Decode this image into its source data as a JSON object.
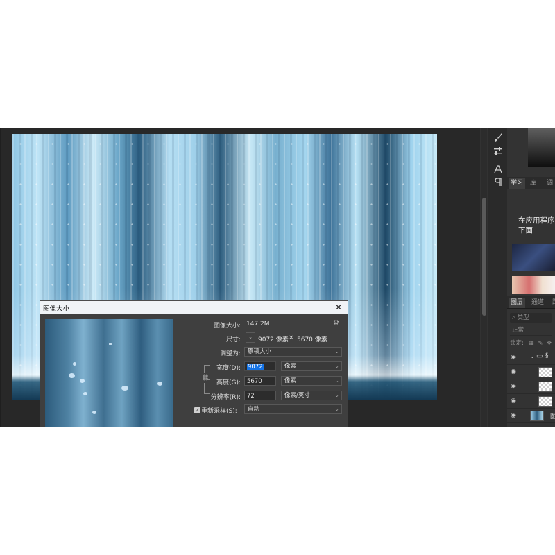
{
  "dialog": {
    "title": "图像大小",
    "close_icon": "close-icon",
    "image_size_label": "图像大小:",
    "image_size_value": "147.2M",
    "dimensions_label": "尺寸:",
    "dimensions_width": "9072 像素",
    "dimensions_times": "×",
    "dimensions_height": "5670 像素",
    "fit_to_label": "调整为:",
    "fit_to_value": "原稿大小",
    "width_label": "宽度(D):",
    "width_value": "9072",
    "width_unit": "像素",
    "height_label": "高度(G):",
    "height_value": "5670",
    "height_unit": "像素",
    "resolution_label": "分辨率(R):",
    "resolution_value": "72",
    "resolution_unit": "像素/英寸",
    "resample_label": "重新采样(S):",
    "resample_checked": true,
    "resample_value": "自动"
  },
  "right_panel": {
    "tabs_top": [
      "学习",
      "库",
      "调"
    ],
    "learn_heading": "在应用程序 下面",
    "tabs_layers": [
      "图层",
      "通道",
      "路"
    ],
    "filter_placeholder": "类型",
    "blend_mode": "正常",
    "lock_label": "锁定:",
    "layer_last_label": "图"
  },
  "tools": [
    "brush-tool-icon",
    "adjust-tool-icon",
    "character-tool-icon",
    "paragraph-tool-icon"
  ],
  "colors": {
    "app_bg": "#323232",
    "dialog_bg": "#3f3f3f",
    "selection": "#1473e6"
  }
}
